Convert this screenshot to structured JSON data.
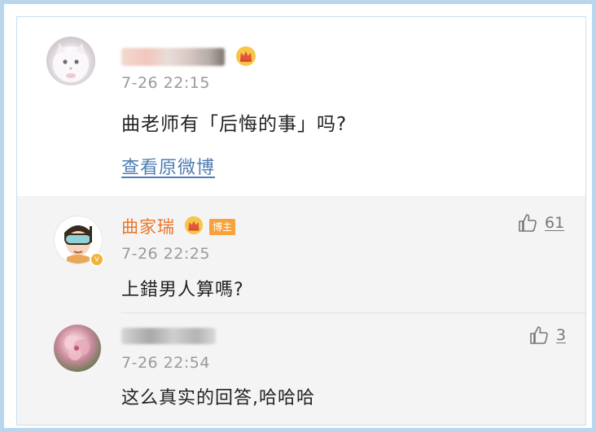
{
  "post": {
    "time": "7-26 22:15",
    "content": "曲老师有「后悔的事」吗?",
    "view_original": "查看原微博"
  },
  "comments": [
    {
      "username": "曲家瑞",
      "badge": "博主",
      "time": "7-26 22:25",
      "content": "上錯男人算嗎?",
      "likes": "61"
    },
    {
      "time": "7-26 22:54",
      "content": "这么真实的回答,哈哈哈",
      "likes": "3"
    }
  ],
  "colors": {
    "frame": "#b9d6ec",
    "username": "#e8762a",
    "link": "#4f7db3",
    "comment_bg": "#f4f4f4"
  }
}
